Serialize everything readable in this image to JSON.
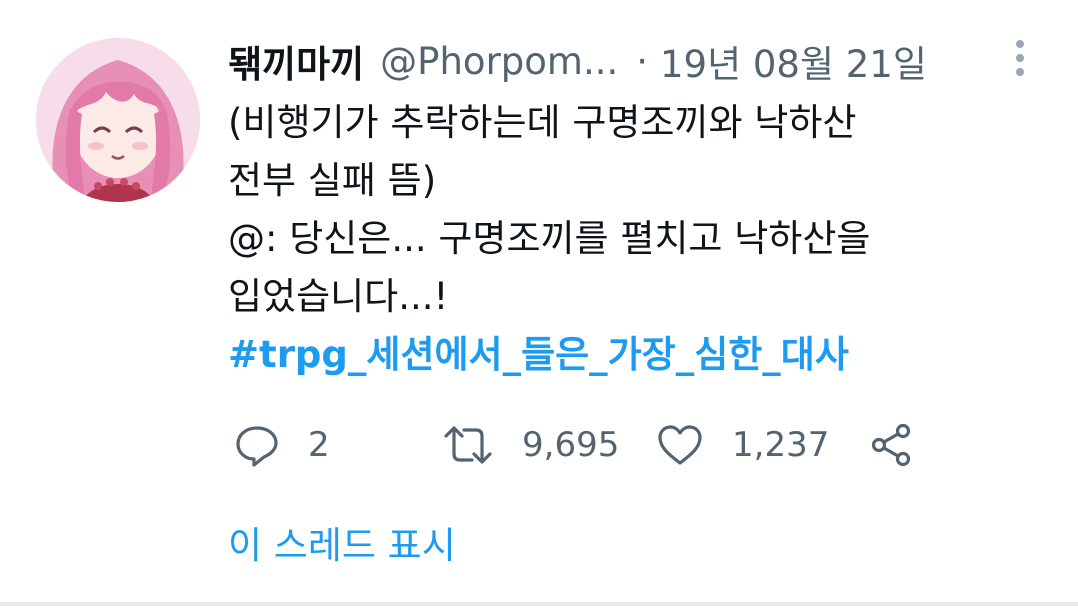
{
  "tweet": {
    "author": {
      "display_name": "돾끼마끼",
      "handle": "@Phorpom...",
      "avatar_icon": "anime-avatar-pink-hair"
    },
    "separator": "·",
    "date": "19년 08월 21일",
    "body_lines": [
      "(비행기가 추락하는데 구명조끼와 낙하산",
      "전부 실패 뜸)",
      "@: 당신은... 구명조끼를 펼치고 낙하산을",
      "입었습니다...!"
    ],
    "hashtag": "#trpg_세션에서_들은_가장_심한_대사",
    "actions": {
      "reply": {
        "icon": "reply-icon",
        "count": "2"
      },
      "retweet": {
        "icon": "retweet-icon",
        "count": "9,695"
      },
      "like": {
        "icon": "heart-icon",
        "count": "1,237"
      },
      "share": {
        "icon": "share-icon"
      }
    },
    "show_thread_label": "이 스레드 표시",
    "more_icon": "more-vertical-icon"
  },
  "colors": {
    "text": "#0f1419",
    "secondary": "#536471",
    "accent": "#1d9bf0",
    "background": "#ffffff"
  }
}
